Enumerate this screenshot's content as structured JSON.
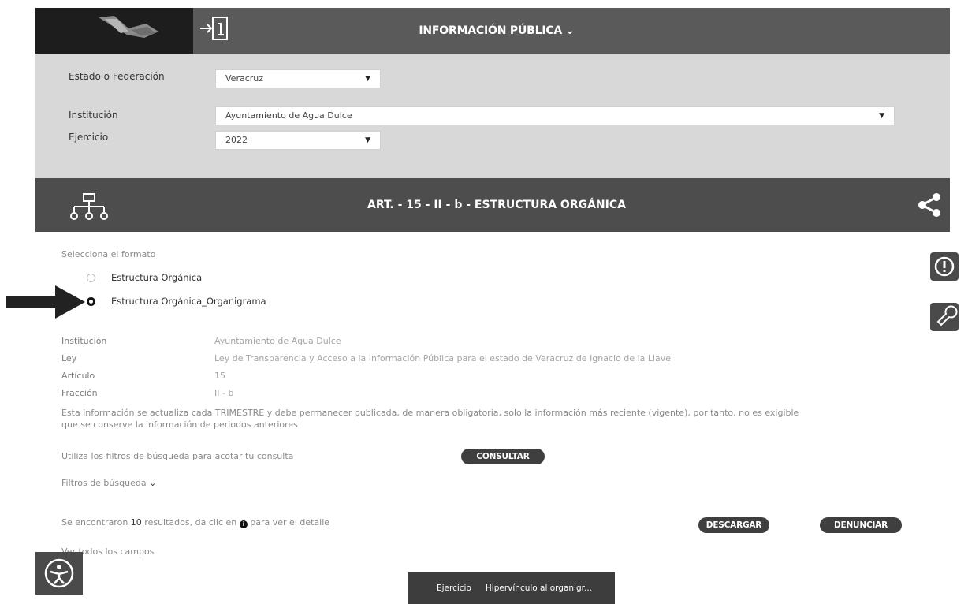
{
  "header": {
    "title": "INFORMACIÓN PÚBLICA",
    "title_chevron": "⌄",
    "login_icon": "login-icon"
  },
  "filters": {
    "estado_label": "Estado o Federación",
    "estado_value": "Veracruz",
    "institucion_label": "Institución",
    "institucion_value": "Ayuntamiento de Agua Dulce",
    "ejercicio_label": "Ejercicio",
    "ejercicio_value": "2022"
  },
  "section": {
    "title": "ART. - 15 - II - b - ESTRUCTURA ORGÁNICA"
  },
  "format": {
    "prompt": "Selecciona el formato",
    "options": [
      {
        "label": "Estructura Orgánica",
        "checked": false
      },
      {
        "label": "Estructura Orgánica_Organigrama",
        "checked": true
      }
    ]
  },
  "info": {
    "institucion_label": "Institución",
    "institucion_value": "Ayuntamiento de Agua Dulce",
    "ley_label": "Ley",
    "ley_value": "Ley de Transparencia y Acceso a la Información Pública para el estado de Veracruz de Ignacio de la Llave",
    "articulo_label": "Artículo",
    "articulo_value": "15",
    "fraccion_label": "Fracción",
    "fraccion_value": "II - b",
    "note_line1": "Esta información se actualiza cada TRIMESTRE y debe permanecer publicada, de manera obligatoria, solo la información más reciente (vigente), por tanto, no es exigible",
    "note_line2": "que se conserve la información de periodos anteriores"
  },
  "query": {
    "hint": "Utiliza los filtros de búsqueda para acotar tu consulta",
    "consultar_label": "CONSULTAR",
    "filters_toggle": "Filtros de búsqueda",
    "filters_chevron": "⌄"
  },
  "results": {
    "prefix": "Se encontraron",
    "count": "10",
    "middle": "resultados, da clic en",
    "suffix": "para ver el detalle",
    "descargar_label": "DESCARGAR",
    "denunciar_label": "DENUNCIAR",
    "all_fields": "Ver todos los campos"
  },
  "table": {
    "columns": [
      "Ejercicio",
      "Hipervínculo al organigr..."
    ]
  },
  "colors": {
    "topbar": "#5a5a5a",
    "filter_panel": "#d8d8d8",
    "section_bar": "#4d4d4d",
    "pill": "#3f3f3f"
  }
}
